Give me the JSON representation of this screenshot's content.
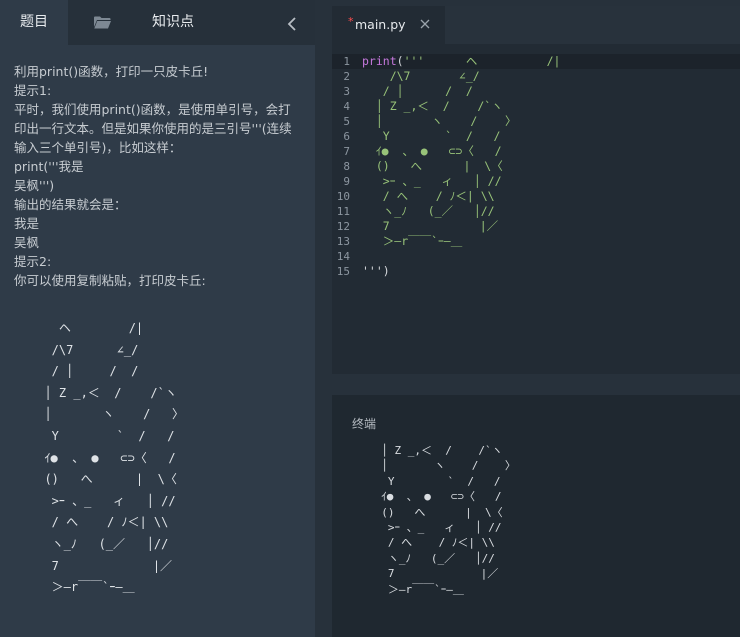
{
  "left_panel": {
    "tabs": {
      "problem": "题目",
      "knowledge": "知识点"
    },
    "problem_lines": [
      "利用print()函数，打印一只皮卡丘!",
      "提示1:",
      "平时，我们使用print()函数，是使用单引号，会打印出一行文本。但是如果你使用的是三引号'''(连续输入三个单引号)，比如这样：",
      "print('''我是",
      "吴枫''')",
      "输出的结果就会是：",
      "我是",
      "吴枫",
      "提示2:",
      "你可以使用复制粘贴，打印皮卡丘:"
    ],
    "ascii_art": "    ヘ        /|\n   /\\7      ∠_/\n   / │     /  /\n  │ Z _,＜  /    /`ヽ\n  │       ヽ    /   〉\n   Y        `  /   /\n  ｲ●  、 ●   ⊂⊃〈   /\n  ()   へ      |  \\〈\n   >ｰ 、_   ィ   │ //\n   / へ    / ﾉ＜| \\\\\n   ヽ_ﾉ   (_／   │//\n   7             |／\n   ＞―r￣￣`ｰ―＿"
  },
  "editor": {
    "file_name": "main.py",
    "lines": [
      {
        "num": "1",
        "kw": "print",
        "paren": "(",
        "text": "'''      ヘ          /|"
      },
      {
        "num": "2",
        "text": "    /\\7       ∠_/"
      },
      {
        "num": "3",
        "text": "   / │      /  /"
      },
      {
        "num": "4",
        "text": "  │ Z _,＜  /    /`ヽ"
      },
      {
        "num": "5",
        "text": "  │       ヽ    /    〉"
      },
      {
        "num": "6",
        "text": "   Y        `  /   /"
      },
      {
        "num": "7",
        "text": "  ｲ●  、 ●   ⊂⊃〈   /"
      },
      {
        "num": "8",
        "text": "  ()   へ      |  \\〈"
      },
      {
        "num": "9",
        "text": "   >ｰ 、_   ィ   │ //"
      },
      {
        "num": "10",
        "text": "   / へ    / ﾉ＜| \\\\"
      },
      {
        "num": "11",
        "text": "   ヽ_ﾉ   (_／   │//"
      },
      {
        "num": "12",
        "text": "   7             |／"
      },
      {
        "num": "13",
        "text": "   ＞―r￣￣`ｰ―＿"
      },
      {
        "num": "14",
        "text": ""
      },
      {
        "num": "15",
        "text": "''')",
        "plain": true
      }
    ]
  },
  "terminal": {
    "title": "终端",
    "output": "  │ Z _,＜  /    /`ヽ\n  │       ヽ    /    〉\n   Y        `  /   /\n  ｲ●  、 ●   ⊂⊃〈   /\n  ()   へ      |  \\〈\n   >ｰ 、_   ィ   │ //\n   / へ    / ﾉ＜| \\\\\n   ヽ_ﾉ   (_／   │//\n   7             |／\n   ＞―r￣￣`ｰ―＿"
  }
}
